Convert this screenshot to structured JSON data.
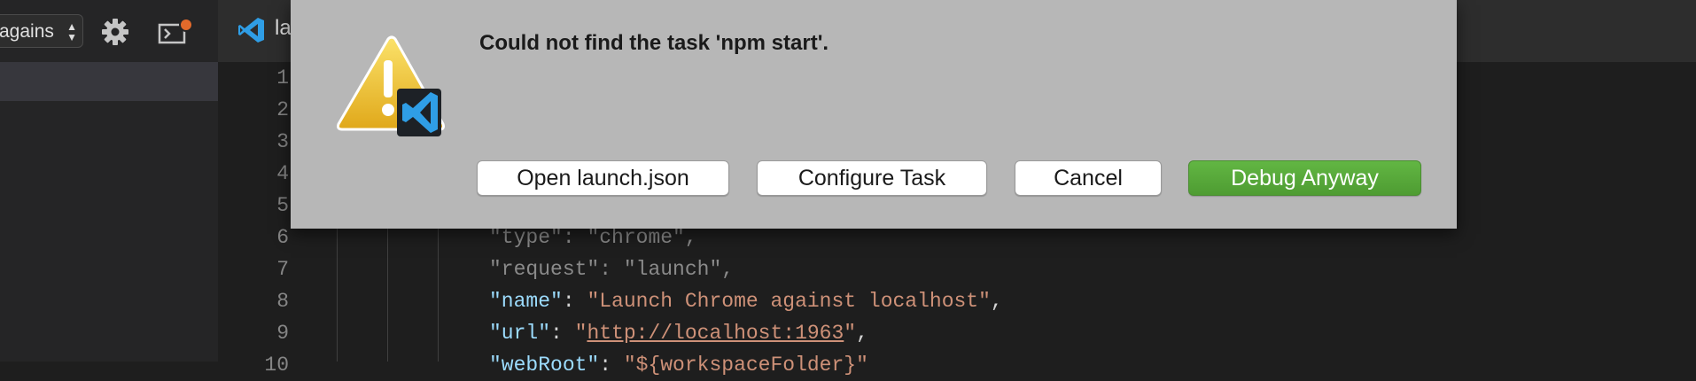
{
  "debug_toolbar": {
    "config_select_value": "agains",
    "gear_icon": "gear-icon",
    "terminal_icon": "debug-console-icon",
    "badge_color": "#e36a2b"
  },
  "tab": {
    "label": "la",
    "icon": "vscode-icon"
  },
  "editor": {
    "line_numbers": [
      "1",
      "2",
      "3",
      "4",
      "5",
      "6",
      "7",
      "8",
      "9",
      "10"
    ],
    "lines": {
      "l6": {
        "key": "\"type\"",
        "sep": ": ",
        "value": "\"chrome\"",
        "end": ","
      },
      "l7": {
        "key": "\"request\"",
        "sep": ": ",
        "value": "\"launch\"",
        "end": ","
      },
      "l8": {
        "key": "\"name\"",
        "sep": ": ",
        "value": "\"Launch Chrome against localhost\"",
        "end": ","
      },
      "l9": {
        "key": "\"url\"",
        "sep": ": ",
        "q1": "\"",
        "link": "http://localhost:1963",
        "q2": "\"",
        "end": ","
      },
      "l10": {
        "key": "\"webRoot\"",
        "sep": ": ",
        "value": "\"${workspaceFolder}\""
      }
    }
  },
  "dialog": {
    "message": "Could not find the task 'npm start'.",
    "buttons": {
      "open_launch": "Open launch.json",
      "configure_task": "Configure Task",
      "cancel": "Cancel",
      "debug_anyway": "Debug Anyway"
    },
    "icon": "warning-icon",
    "accent": "#55a838"
  }
}
